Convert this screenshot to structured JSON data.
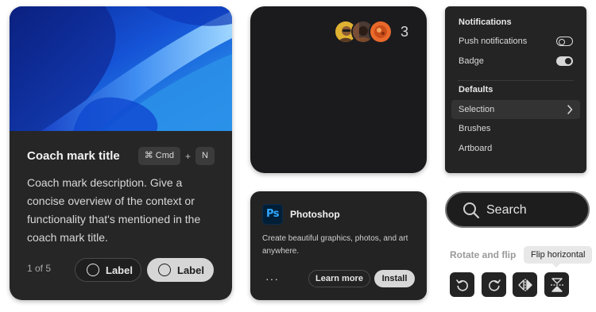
{
  "coach_mark": {
    "title": "Coach mark title",
    "shortcut_keys": [
      "⌘ Cmd",
      "N"
    ],
    "shortcut_separator": "+",
    "description": "Coach mark description. Give a concise overview of the context or functionality that's mentioned in the coach mark title.",
    "step": "1 of 5",
    "secondary_button_label": "Label",
    "primary_button_label": "Label"
  },
  "avatar_group": {
    "avatars": [
      "avatar-1",
      "avatar-2",
      "avatar-3"
    ],
    "overflow_count": "3"
  },
  "menu": {
    "section1_heading": "Notifications",
    "push_notifications_label": "Push notifications",
    "push_notifications_on": false,
    "badge_label": "Badge",
    "badge_on": true,
    "section2_heading": "Defaults",
    "items": [
      "Selection",
      "Brushes",
      "Artboard"
    ],
    "selected_item": "Selection"
  },
  "app_card": {
    "logo_text": "Ps",
    "name": "Photoshop",
    "description": "Create beautiful graphics, photos, and art anywhere.",
    "more_label": "···",
    "learn_more_label": "Learn more",
    "install_label": "Install"
  },
  "search": {
    "placeholder": "Search"
  },
  "rotate_flip": {
    "label": "Rotate and flip",
    "tooltip": "Flip horizontal",
    "tools": [
      "rotate-left-icon",
      "rotate-right-icon",
      "flip-horizontal-icon",
      "flip-vertical-icon"
    ]
  },
  "colors": {
    "card_bg": "#262626",
    "accent_blue": "#31a8ff",
    "ps_bg": "#001e36"
  }
}
